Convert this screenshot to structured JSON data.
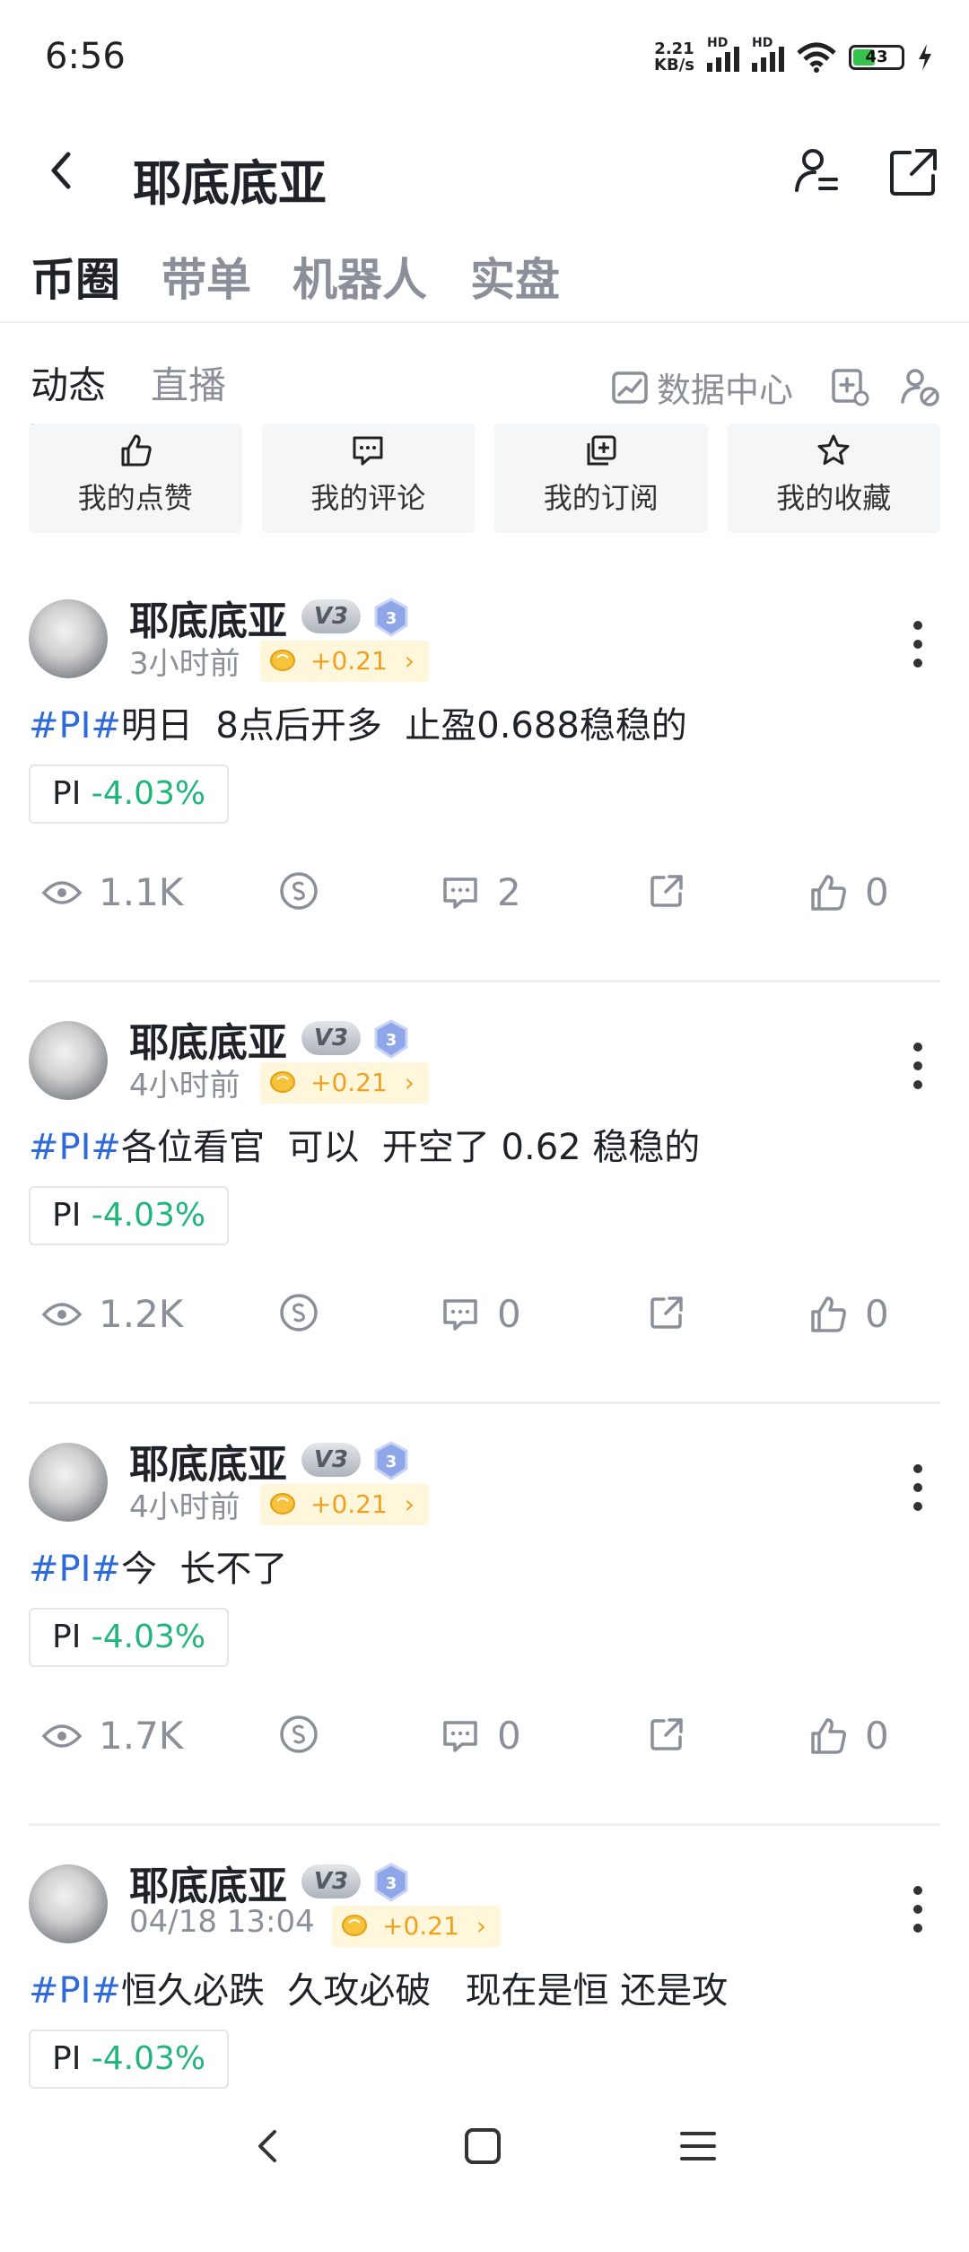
{
  "status_bar": {
    "time": "6:56",
    "net_speed": "2.21",
    "net_unit": "KB/s",
    "hd1": "HD",
    "hd2": "HD",
    "battery": "43"
  },
  "header": {
    "title": "耶底底亚"
  },
  "categories": [
    "币圈",
    "带单",
    "机器人",
    "实盘"
  ],
  "sub_tabs": [
    "动态",
    "直播"
  ],
  "data_center_label": "数据中心",
  "quick_actions": [
    {
      "label": "我的点赞",
      "icon": "thumb-up-icon"
    },
    {
      "label": "我的评论",
      "icon": "comment-icon"
    },
    {
      "label": "我的订阅",
      "icon": "subscribe-icon"
    },
    {
      "label": "我的收藏",
      "icon": "star-icon"
    }
  ],
  "posts": [
    {
      "name": "耶底底亚",
      "badge": "V3",
      "level": "3",
      "time": "3小时前",
      "reward": "+0.21",
      "tag": "#PI#",
      "text": "明日  8点后开多  止盈0.688稳稳的",
      "coin": "PI",
      "change": "-4.03%",
      "views": "1.1K",
      "comments": "2",
      "likes": "0"
    },
    {
      "name": "耶底底亚",
      "badge": "V3",
      "level": "3",
      "time": "4小时前",
      "reward": "+0.21",
      "tag": "#PI#",
      "text": "各位看官  可以  开空了 0.62 稳稳的",
      "coin": "PI",
      "change": "-4.03%",
      "views": "1.2K",
      "comments": "0",
      "likes": "0"
    },
    {
      "name": "耶底底亚",
      "badge": "V3",
      "level": "3",
      "time": "4小时前",
      "reward": "+0.21",
      "tag": "#PI#",
      "text": "今  长不了",
      "coin": "PI",
      "change": "-4.03%",
      "views": "1.7K",
      "comments": "0",
      "likes": "0"
    },
    {
      "name": "耶底底亚",
      "badge": "V3",
      "level": "3",
      "time": "04/18 13:04",
      "reward": "+0.21",
      "tag": "#PI#",
      "text": "恒久必跌  久攻必破   现在是恒 还是攻",
      "coin": "PI",
      "change": "-4.03%",
      "views": "",
      "comments": "",
      "likes": ""
    }
  ],
  "colors": {
    "tag": "#2f6bd8",
    "down": "#21b57a",
    "reward": "#f0a020",
    "muted": "#8a8f99"
  }
}
